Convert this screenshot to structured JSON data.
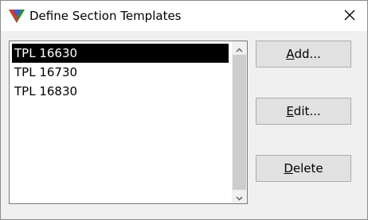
{
  "window": {
    "title": "Define Section Templates",
    "app_icon": "triangle-logo-icon",
    "close_icon": "close-icon"
  },
  "list": {
    "items": [
      "TPL 16630",
      "TPL 16730",
      "TPL 16830"
    ],
    "selected_index": 0
  },
  "buttons": {
    "add": {
      "mnemonic": "A",
      "rest": "dd..."
    },
    "edit": {
      "mnemonic": "E",
      "rest": "dit..."
    },
    "delete": {
      "mnemonic": "D",
      "rest": "elete"
    }
  }
}
